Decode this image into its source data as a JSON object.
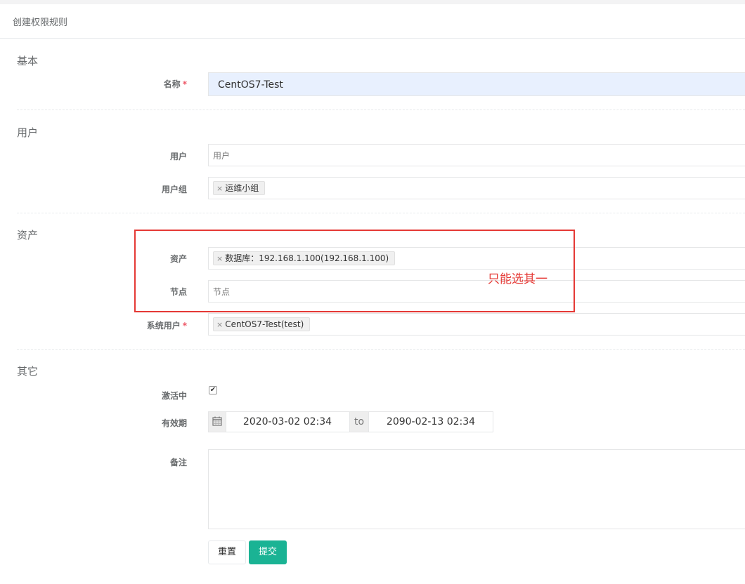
{
  "panel": {
    "title": "创建权限规则"
  },
  "sections": {
    "basic": "基本",
    "user": "用户",
    "asset": "资产",
    "other": "其它"
  },
  "fields": {
    "name": {
      "label": "名称",
      "required": "*",
      "value": "CentOS7-Test"
    },
    "users": {
      "label": "用户",
      "placeholder": "用户"
    },
    "user_groups": {
      "label": "用户组",
      "tags": [
        "运维小组"
      ]
    },
    "assets": {
      "label": "资产",
      "tags": [
        "数据库：192.168.1.100(192.168.1.100)"
      ]
    },
    "nodes": {
      "label": "节点",
      "placeholder": "节点"
    },
    "system_users": {
      "label": "系统用户",
      "required": "*",
      "tags": [
        "CentOS7-Test(test)"
      ]
    },
    "is_active": {
      "label": "激活中",
      "checked": true
    },
    "date_range": {
      "label": "有效期",
      "start": "2020-03-02 02:34",
      "separator": "to",
      "end": "2090-02-13 02:34"
    },
    "comment": {
      "label": "备注",
      "value": ""
    }
  },
  "annotation": {
    "text": "只能选其一",
    "color": "#e53935"
  },
  "buttons": {
    "reset": "重置",
    "submit": "提交"
  },
  "colors": {
    "primary": "#1ab394",
    "required": "#ed5565",
    "autofill": "#e8f0fe"
  },
  "icons": {
    "tag_remove": "×",
    "calendar": "calendar-icon",
    "check": "✔"
  }
}
